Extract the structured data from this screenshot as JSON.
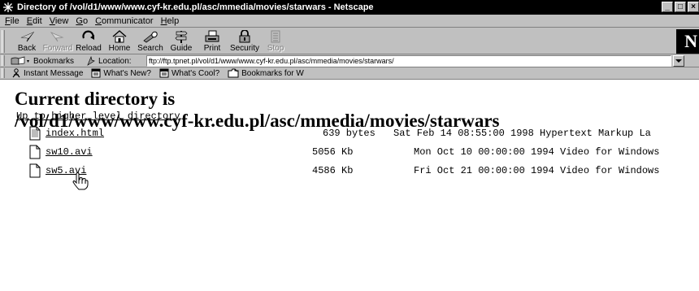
{
  "window": {
    "title": "Directory of /vol/d1/www/www.cyf-kr.edu.pl/asc/mmedia/movies/starwars - Netscape",
    "buttons": [
      "_",
      "□",
      "×"
    ]
  },
  "menu": [
    {
      "label": "File",
      "key": "F",
      "rest": "ile"
    },
    {
      "label": "Edit",
      "key": "E",
      "rest": "dit"
    },
    {
      "label": "View",
      "key": "V",
      "rest": "iew"
    },
    {
      "label": "Go",
      "key": "G",
      "rest": "o"
    },
    {
      "label": "Communicator",
      "key": "C",
      "rest": "ommunicator"
    },
    {
      "label": "Help",
      "key": "H",
      "rest": "elp"
    }
  ],
  "toolbar": {
    "back": "Back",
    "forward": "Forward",
    "reload": "Reload",
    "home": "Home",
    "search": "Search",
    "guide": "Guide",
    "print": "Print",
    "security": "Security",
    "stop": "Stop",
    "logo": "N"
  },
  "location": {
    "bookmarks_label": "Bookmarks",
    "location_label": "Location:",
    "url": "ftp://ftp.tpnet.pl/vol/d1/www/www.cyf-kr.edu.pl/asc/mmedia/movies/starwars/"
  },
  "personal": {
    "instant_message": "Instant Message",
    "whats_new": "What's New?",
    "whats_cool": "What's Cool?",
    "bookmarks_for": "Bookmarks for W"
  },
  "page": {
    "heading_line1": "Current directory is",
    "heading_line2": "/vol/d1/www/www.cyf-kr.edu.pl/asc/mmedia/movies/starwars",
    "up_link": "Up to higher level directory",
    "files": [
      {
        "name": "index.html",
        "icon": "html-file-icon",
        "size": "639 bytes",
        "date": "Sat Feb 14 08:55:00 1998 Hypertext Markup La"
      },
      {
        "name": "sw10.avi",
        "icon": "file-icon",
        "size": "5056 Kb",
        "date": "Mon Oct 10 00:00:00 1994 Video for Windows"
      },
      {
        "name": "sw5.avi",
        "icon": "file-icon",
        "size": "4586 Kb",
        "date": "Fri Oct 21 00:00:00 1994 Video for Windows"
      }
    ]
  }
}
